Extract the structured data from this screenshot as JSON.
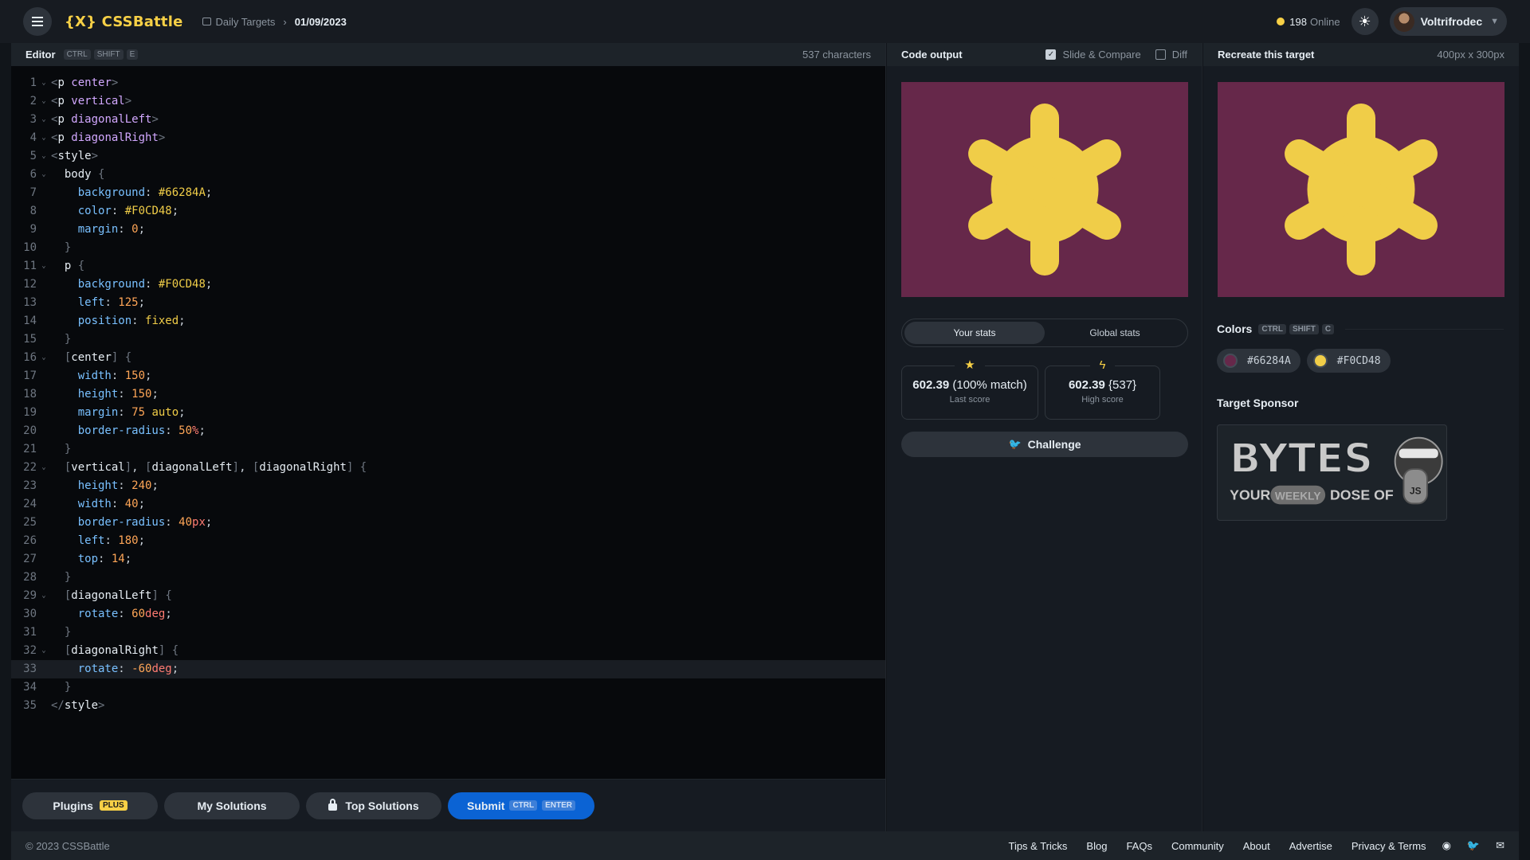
{
  "header": {
    "logo": "{X} CSSBattle",
    "crumb_section": "Daily Targets",
    "crumb_separator": "›",
    "crumb_date": "01/09/2023",
    "online_count": "198",
    "online_label": "Online",
    "username": "Voltrifrodec"
  },
  "editor": {
    "title": "Editor",
    "shortcut": [
      "CTRL",
      "SHIFT",
      "E"
    ],
    "char_count": "537 characters",
    "active_line": 33,
    "lines": [
      [
        [
          "<",
          "c-punc"
        ],
        [
          "p",
          "tag"
        ],
        [
          " center",
          "c-attr"
        ],
        [
          ">",
          "c-punc"
        ]
      ],
      [
        [
          "<",
          "c-punc"
        ],
        [
          "p",
          "tag"
        ],
        [
          " vertical",
          "c-attr"
        ],
        [
          ">",
          "c-punc"
        ]
      ],
      [
        [
          "<",
          "c-punc"
        ],
        [
          "p",
          "tag"
        ],
        [
          " diagonalLeft",
          "c-attr"
        ],
        [
          ">",
          "c-punc"
        ]
      ],
      [
        [
          "<",
          "c-punc"
        ],
        [
          "p",
          "tag"
        ],
        [
          " diagonalRight",
          "c-attr"
        ],
        [
          ">",
          "c-punc"
        ]
      ],
      [
        [
          "<",
          "c-punc"
        ],
        [
          "style",
          "tag"
        ],
        [
          ">",
          "c-punc"
        ]
      ],
      [
        [
          "  ",
          "c-txt"
        ],
        [
          "body",
          "c-sel"
        ],
        [
          " {",
          "c-punc"
        ]
      ],
      [
        [
          "    ",
          "c-txt"
        ],
        [
          "background",
          "c-prop"
        ],
        [
          ": ",
          "c-txt"
        ],
        [
          "#66284A",
          "c-val"
        ],
        [
          ";",
          "c-txt"
        ]
      ],
      [
        [
          "    ",
          "c-txt"
        ],
        [
          "color",
          "c-prop"
        ],
        [
          ": ",
          "c-txt"
        ],
        [
          "#F0CD48",
          "c-val"
        ],
        [
          ";",
          "c-txt"
        ]
      ],
      [
        [
          "    ",
          "c-txt"
        ],
        [
          "margin",
          "c-prop"
        ],
        [
          ": ",
          "c-txt"
        ],
        [
          "0",
          "c-num"
        ],
        [
          ";",
          "c-txt"
        ]
      ],
      [
        [
          "  ",
          "c-txt"
        ],
        [
          "}",
          "c-punc"
        ]
      ],
      [
        [
          "  ",
          "c-txt"
        ],
        [
          "p",
          "c-sel"
        ],
        [
          " {",
          "c-punc"
        ]
      ],
      [
        [
          "    ",
          "c-txt"
        ],
        [
          "background",
          "c-prop"
        ],
        [
          ": ",
          "c-txt"
        ],
        [
          "#F0CD48",
          "c-val"
        ],
        [
          ";",
          "c-txt"
        ]
      ],
      [
        [
          "    ",
          "c-txt"
        ],
        [
          "left",
          "c-prop"
        ],
        [
          ": ",
          "c-txt"
        ],
        [
          "125",
          "c-num"
        ],
        [
          ";",
          "c-txt"
        ]
      ],
      [
        [
          "    ",
          "c-txt"
        ],
        [
          "position",
          "c-prop"
        ],
        [
          ": ",
          "c-txt"
        ],
        [
          "fixed",
          "c-val"
        ],
        [
          ";",
          "c-txt"
        ]
      ],
      [
        [
          "  ",
          "c-txt"
        ],
        [
          "}",
          "c-punc"
        ]
      ],
      [
        [
          "  ",
          "c-txt"
        ],
        [
          "[",
          "c-punc"
        ],
        [
          "center",
          "c-sel"
        ],
        [
          "]",
          "c-punc"
        ],
        [
          " {",
          "c-punc"
        ]
      ],
      [
        [
          "    ",
          "c-txt"
        ],
        [
          "width",
          "c-prop"
        ],
        [
          ": ",
          "c-txt"
        ],
        [
          "150",
          "c-num"
        ],
        [
          ";",
          "c-txt"
        ]
      ],
      [
        [
          "    ",
          "c-txt"
        ],
        [
          "height",
          "c-prop"
        ],
        [
          ": ",
          "c-txt"
        ],
        [
          "150",
          "c-num"
        ],
        [
          ";",
          "c-txt"
        ]
      ],
      [
        [
          "    ",
          "c-txt"
        ],
        [
          "margin",
          "c-prop"
        ],
        [
          ": ",
          "c-txt"
        ],
        [
          "75",
          "c-num"
        ],
        [
          " auto",
          "c-val"
        ],
        [
          ";",
          "c-txt"
        ]
      ],
      [
        [
          "    ",
          "c-txt"
        ],
        [
          "border-radius",
          "c-prop"
        ],
        [
          ": ",
          "c-txt"
        ],
        [
          "50",
          "c-num"
        ],
        [
          "%",
          "c-unit"
        ],
        [
          ";",
          "c-txt"
        ]
      ],
      [
        [
          "  ",
          "c-txt"
        ],
        [
          "}",
          "c-punc"
        ]
      ],
      [
        [
          "  ",
          "c-txt"
        ],
        [
          "[",
          "c-punc"
        ],
        [
          "vertical",
          "c-sel"
        ],
        [
          "]",
          "c-punc"
        ],
        [
          ", ",
          "c-txt"
        ],
        [
          "[",
          "c-punc"
        ],
        [
          "diagonalLeft",
          "c-sel"
        ],
        [
          "]",
          "c-punc"
        ],
        [
          ", ",
          "c-txt"
        ],
        [
          "[",
          "c-punc"
        ],
        [
          "diagonalRight",
          "c-sel"
        ],
        [
          "]",
          "c-punc"
        ],
        [
          " {",
          "c-punc"
        ]
      ],
      [
        [
          "    ",
          "c-txt"
        ],
        [
          "height",
          "c-prop"
        ],
        [
          ": ",
          "c-txt"
        ],
        [
          "240",
          "c-num"
        ],
        [
          ";",
          "c-txt"
        ]
      ],
      [
        [
          "    ",
          "c-txt"
        ],
        [
          "width",
          "c-prop"
        ],
        [
          ": ",
          "c-txt"
        ],
        [
          "40",
          "c-num"
        ],
        [
          ";",
          "c-txt"
        ]
      ],
      [
        [
          "    ",
          "c-txt"
        ],
        [
          "border-radius",
          "c-prop"
        ],
        [
          ": ",
          "c-txt"
        ],
        [
          "40",
          "c-num"
        ],
        [
          "px",
          "c-unit"
        ],
        [
          ";",
          "c-txt"
        ]
      ],
      [
        [
          "    ",
          "c-txt"
        ],
        [
          "left",
          "c-prop"
        ],
        [
          ": ",
          "c-txt"
        ],
        [
          "180",
          "c-num"
        ],
        [
          ";",
          "c-txt"
        ]
      ],
      [
        [
          "    ",
          "c-txt"
        ],
        [
          "top",
          "c-prop"
        ],
        [
          ": ",
          "c-txt"
        ],
        [
          "14",
          "c-num"
        ],
        [
          ";",
          "c-txt"
        ]
      ],
      [
        [
          "  ",
          "c-txt"
        ],
        [
          "}",
          "c-punc"
        ]
      ],
      [
        [
          "  ",
          "c-txt"
        ],
        [
          "[",
          "c-punc"
        ],
        [
          "diagonalLeft",
          "c-sel"
        ],
        [
          "]",
          "c-punc"
        ],
        [
          " {",
          "c-punc"
        ]
      ],
      [
        [
          "    ",
          "c-txt"
        ],
        [
          "rotate",
          "c-prop"
        ],
        [
          ": ",
          "c-txt"
        ],
        [
          "60",
          "c-num"
        ],
        [
          "deg",
          "c-unit"
        ],
        [
          ";",
          "c-txt"
        ]
      ],
      [
        [
          "  ",
          "c-txt"
        ],
        [
          "}",
          "c-punc"
        ]
      ],
      [
        [
          "  ",
          "c-txt"
        ],
        [
          "[",
          "c-punc"
        ],
        [
          "diagonalRight",
          "c-sel"
        ],
        [
          "]",
          "c-punc"
        ],
        [
          " {",
          "c-punc"
        ]
      ],
      [
        [
          "    ",
          "c-txt"
        ],
        [
          "rotate",
          "c-prop"
        ],
        [
          ": ",
          "c-txt"
        ],
        [
          "-60",
          "c-num"
        ],
        [
          "deg",
          "c-unit"
        ],
        [
          ";",
          "c-txt"
        ]
      ],
      [
        [
          "  ",
          "c-txt"
        ],
        [
          "}",
          "c-punc"
        ]
      ],
      [
        [
          "</",
          "c-punc"
        ],
        [
          "style",
          "tag"
        ],
        [
          ">",
          "c-punc"
        ]
      ]
    ],
    "fold_lines": [
      1,
      2,
      3,
      4,
      5,
      6,
      11,
      16,
      22,
      29,
      32
    ]
  },
  "footer_buttons": {
    "plugins": "Plugins",
    "plugins_badge": "PLUS",
    "my_solutions": "My Solutions",
    "top_solutions": "Top Solutions",
    "submit": "Submit",
    "submit_keys": [
      "CTRL",
      "ENTER"
    ]
  },
  "output": {
    "title": "Code output",
    "slide_compare": "Slide & Compare",
    "slide_compare_checked": true,
    "diff": "Diff",
    "diff_checked": false,
    "tab_your": "Your stats",
    "tab_global": "Global stats",
    "last_score_value": "602.39",
    "last_score_extra": "(100% match)",
    "last_score_label": "Last score",
    "high_score_value": "602.39",
    "high_score_extra": "{537}",
    "high_score_label": "High score",
    "challenge": "Challenge"
  },
  "target": {
    "title": "Recreate this target",
    "size": "400px x 300px",
    "colors_title": "Colors",
    "colors_keys": [
      "CTRL",
      "SHIFT",
      "C"
    ],
    "colors": [
      "#66284A",
      "#F0CD48"
    ],
    "sponsor_title": "Target Sponsor",
    "sponsor_word": "BYTES",
    "sponsor_tagline_1": "YOUR",
    "sponsor_tagline_2": "WEEKLY",
    "sponsor_tagline_3": "DOSE OF",
    "sponsor_js": "JS"
  },
  "art": {
    "bg": "#66284A",
    "fg": "#F0CD48"
  },
  "footer": {
    "copyright": "© 2023 CSSBattle",
    "links": [
      "Tips & Tricks",
      "Blog",
      "FAQs",
      "Community",
      "About",
      "Advertise",
      "Privacy & Terms"
    ]
  }
}
